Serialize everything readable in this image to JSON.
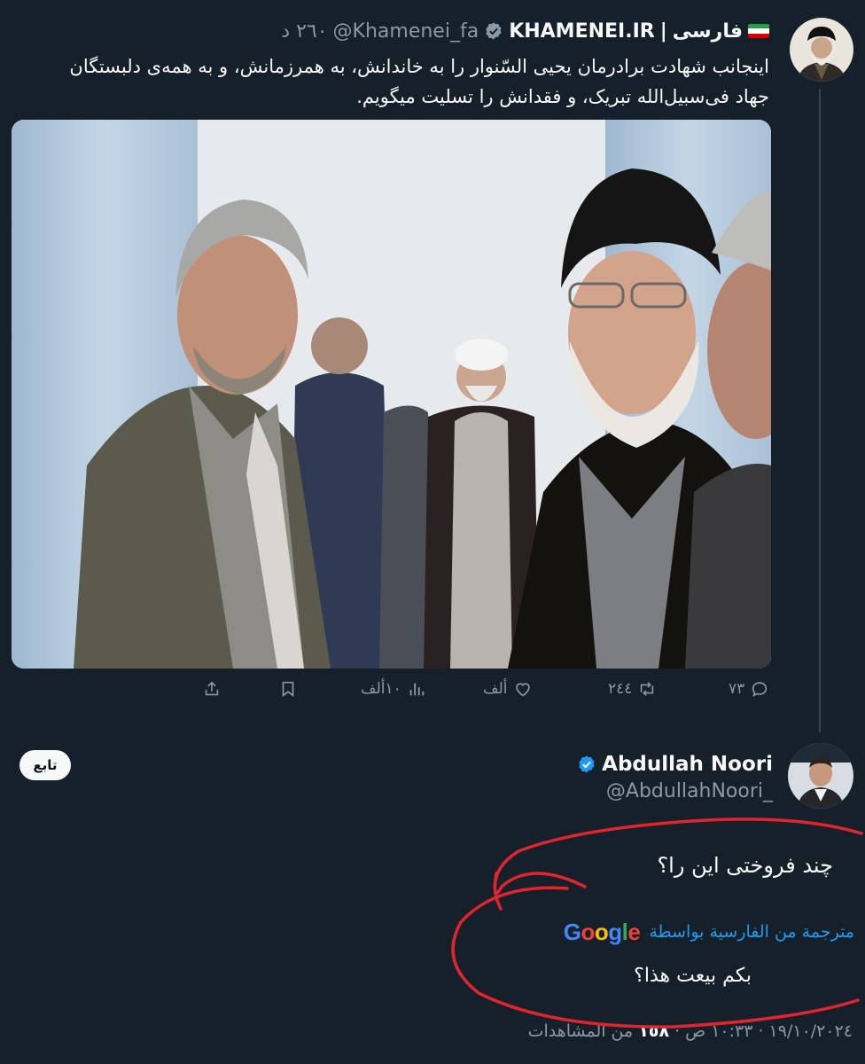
{
  "tweet1": {
    "lang_label": "فارسی",
    "separator": "|",
    "display_name": "KHAMENEI.IR",
    "handle": "@Khamenei_fa",
    "time": "٢٦٠ د",
    "text_line1": "اینجانب شهادت برادرمان یحیی السّنوار را به خاندانش، به همرزمانش، و به همه‌ی دلبستگان",
    "text_line2": "جهاد فی‌سبیل‌الله تبریک، و فقدانش را تسلیت میگویم.",
    "actions": {
      "replies": "٧٣",
      "reposts": "٢٤٤",
      "likes": "ألف",
      "views": "١٠ألف"
    }
  },
  "tweet2": {
    "display_name": "Abdullah Noori",
    "handle": "@AbdullahNoori_",
    "follow_label": "تابع",
    "text": "چند فروختی این را؟",
    "translated_label": "مترجمة من الفارسية بواسطة",
    "translation": "بكم بيعت هذا؟",
    "meta_prefix": "١٩/١٠/٢٠٢٤ · ١٠:٣٣ ص ·",
    "views_count": "١٥٨",
    "views_label": "من المشاهدات"
  },
  "branding": {
    "google": [
      "G",
      "o",
      "o",
      "g",
      "l",
      "e"
    ]
  },
  "colors": {
    "background": "#15202b",
    "text": "#f7f9f9",
    "muted": "#8b98a5",
    "accent": "#1d9bf0",
    "annotation": "#e0252f"
  },
  "icons": [
    "verified-badge-icon",
    "reply-icon",
    "repost-icon",
    "like-icon",
    "views-icon",
    "bookmark-icon",
    "share-icon",
    "iran-flag-icon"
  ]
}
